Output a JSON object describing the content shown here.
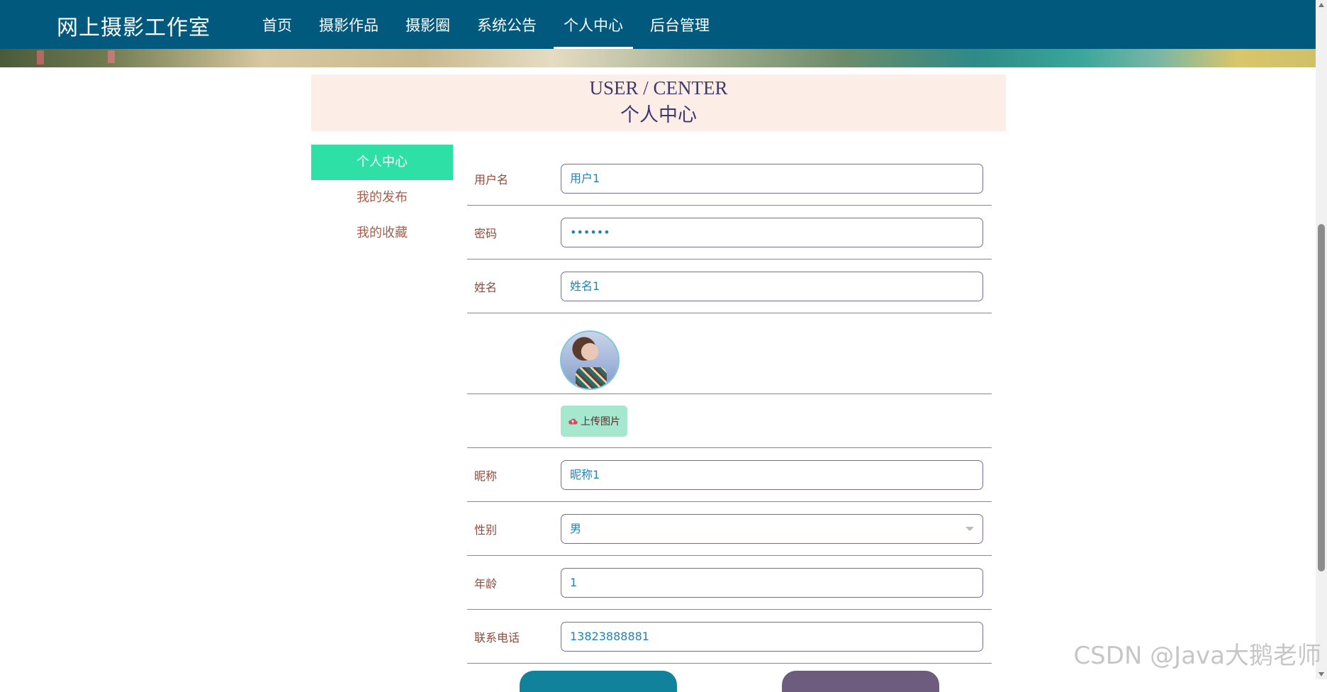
{
  "header": {
    "site_title": "网上摄影工作室",
    "nav": [
      {
        "label": "首页"
      },
      {
        "label": "摄影作品"
      },
      {
        "label": "摄影圈"
      },
      {
        "label": "系统公告"
      },
      {
        "label": "个人中心"
      },
      {
        "label": "后台管理"
      }
    ],
    "active_nav": "个人中心"
  },
  "page_head": {
    "en_title": "USER / CENTER",
    "cn_title": "个人中心"
  },
  "side_menu": {
    "items": [
      {
        "label": "个人中心",
        "active": true
      },
      {
        "label": "我的发布",
        "active": false
      },
      {
        "label": "我的收藏",
        "active": false
      }
    ]
  },
  "form": {
    "username": {
      "label": "用户名",
      "value": "用户1"
    },
    "password": {
      "label": "密码",
      "value": "••••••"
    },
    "realname": {
      "label": "姓名",
      "value": "姓名1"
    },
    "upload": {
      "label": "上传图片"
    },
    "nickname": {
      "label": "昵称",
      "value": "昵称1"
    },
    "gender": {
      "label": "性别",
      "value": "男"
    },
    "age": {
      "label": "年龄",
      "value": "1"
    },
    "phone": {
      "label": "联系电话",
      "value": "13823888881"
    }
  },
  "watermark": "CSDN @Java大鹅老师",
  "colors": {
    "topbar": "#015a7d",
    "active_side": "#2ee0a5",
    "head_bg": "#fcede6",
    "label": "#8e4a3a",
    "value": "#1e84b3"
  }
}
